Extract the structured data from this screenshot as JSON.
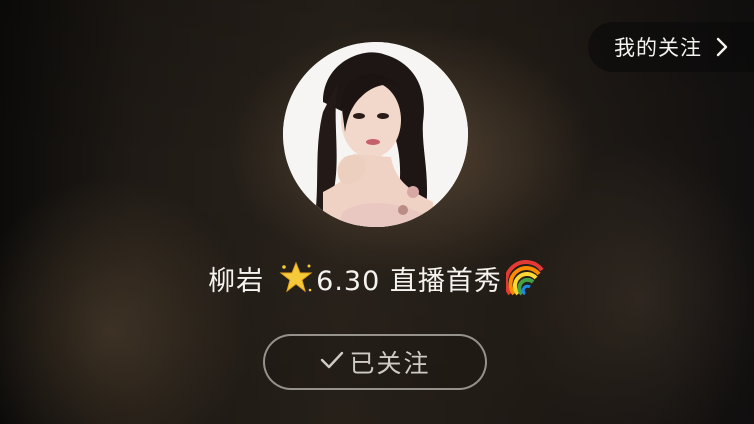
{
  "header": {
    "my_follow_label": "我的关注",
    "chevron_icon": "chevron-right-icon"
  },
  "profile": {
    "avatar_icon": "avatar-photo",
    "name": "柳岩",
    "star_icon": "glowing-star-icon",
    "headline": "6.30 直播首秀",
    "rainbow_icon": "rainbow-icon"
  },
  "follow_button": {
    "check_icon": "checkmark-icon",
    "label": "已关注"
  },
  "colors": {
    "text": "#f5f3ef",
    "button_border": "#c8c4be",
    "button_text": "#cfcbc5",
    "pill_bg": "#0a0a0a"
  }
}
